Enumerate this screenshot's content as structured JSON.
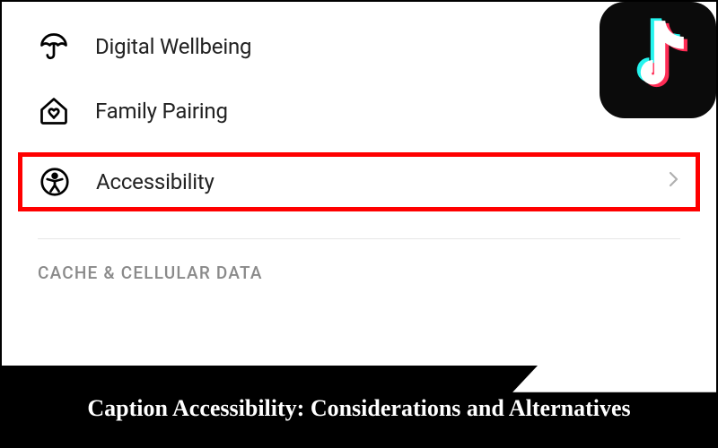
{
  "settings": {
    "items": [
      {
        "icon": "umbrella-icon",
        "label": "Digital Wellbeing"
      },
      {
        "icon": "family-home-icon",
        "label": "Family Pairing"
      },
      {
        "icon": "accessibility-icon",
        "label": "Accessibility",
        "highlighted": true,
        "chevron": true
      }
    ],
    "section_header": "CACHE & CELLULAR DATA"
  },
  "brand": {
    "name": "TikTok"
  },
  "caption": {
    "text": "Caption Accessibility: Considerations and Alternatives"
  }
}
